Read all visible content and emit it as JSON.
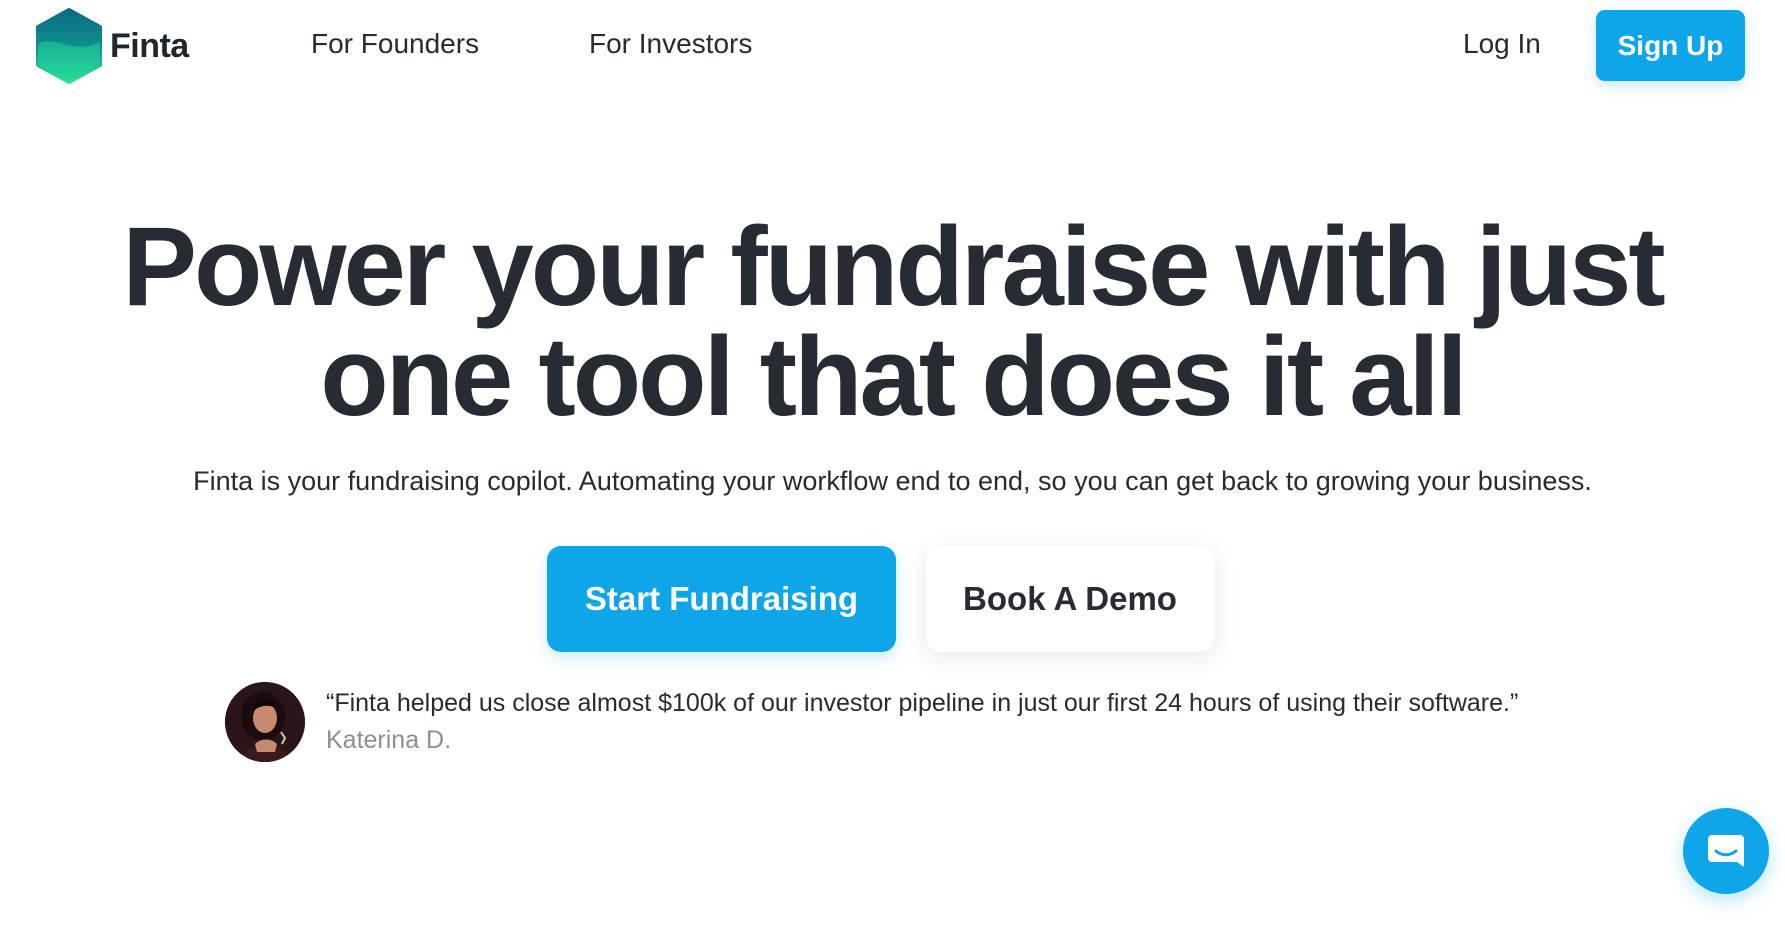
{
  "header": {
    "brand_name": "Finta",
    "nav": {
      "founders_label": "For Founders",
      "investors_label": "For Investors"
    },
    "login_label": "Log In",
    "signup_label": "Sign Up"
  },
  "hero": {
    "title_line1": "Power your fundraise with just",
    "title_line2": "one tool that does it all",
    "subtitle": "Finta is your fundraising copilot. Automating your workflow end to end, so you can get back to growing your business.",
    "primary_cta": "Start Fundraising",
    "secondary_cta": "Book A Demo"
  },
  "testimonial": {
    "quote": "“Finta helped us close almost $100k of our investor pipeline in just our first 24 hours of using their software.”",
    "author": "Katerina D."
  },
  "icons": {
    "logo": "finta-logo-icon",
    "avatar": "user-avatar",
    "chat": "chat-bubble-icon"
  },
  "colors": {
    "accent": "#0ea5e9",
    "text": "#262b34",
    "muted": "#8a9099",
    "logo_top": "#0b6f86",
    "logo_bottom": "#2de08e"
  }
}
